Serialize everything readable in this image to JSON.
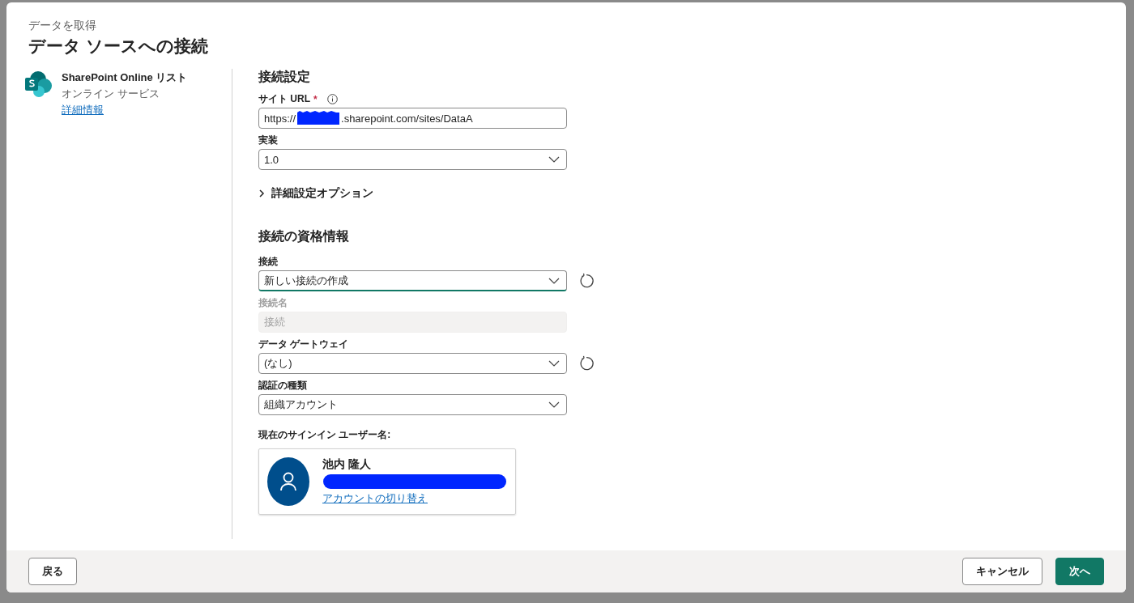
{
  "dialog": {
    "breadcrumb": "データを取得",
    "title": "データ ソースへの接続"
  },
  "source": {
    "name": "SharePoint Online リスト",
    "category": "オンライン サービス",
    "link": "詳細情報"
  },
  "connection_settings": {
    "heading": "接続設定",
    "site_url": {
      "label": "サイト URL",
      "required_marker": "*",
      "value_prefix": "https://",
      "redacted": true,
      "value_suffix": ".sharepoint.com/sites/DataA"
    },
    "implementation": {
      "label": "実装",
      "value": "1.0"
    },
    "advanced": {
      "label": "詳細設定オプション",
      "expanded": false
    }
  },
  "credentials": {
    "heading": "接続の資格情報",
    "fields": [
      {
        "kind": "select",
        "label": "接続",
        "value": "新しい接続の作成",
        "focused": true,
        "refresh": true
      },
      {
        "kind": "text",
        "label": "接続名",
        "placeholder": "接続",
        "disabled": true
      },
      {
        "kind": "select",
        "label": "データ ゲートウェイ",
        "value": "(なし)",
        "focused": false,
        "refresh": true
      },
      {
        "kind": "select",
        "label": "認証の種類",
        "value": "組織アカウント",
        "focused": false,
        "refresh": false
      }
    ],
    "signed_in": {
      "label": "現在のサインイン ユーザー名:",
      "user_name": "池内 隆人",
      "email_redacted": true,
      "switch_link": "アカウントの切り替え"
    }
  },
  "footer": {
    "back": "戻る",
    "cancel": "キャンセル",
    "next": "次へ"
  }
}
